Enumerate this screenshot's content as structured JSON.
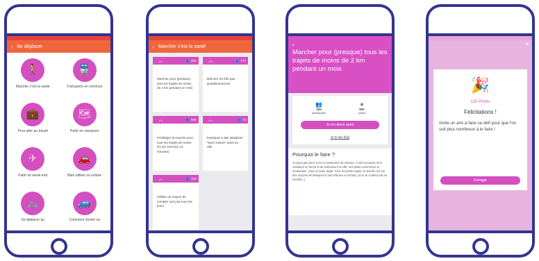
{
  "screen1": {
    "title": "Se déplacer",
    "items": [
      {
        "label": "Marcher c'est la santé",
        "icon": "🚶"
      },
      {
        "label": "Transports en commun",
        "icon": "🚆"
      },
      {
        "label": "Pour aller au travail",
        "icon": "💼"
      },
      {
        "label": "Partir en vacances",
        "icon": "🗺"
      },
      {
        "label": "Partir en week-end",
        "icon": "✈"
      },
      {
        "label": "Bien utiliser sa voiture",
        "icon": "🚗"
      },
      {
        "label": "Se déplacer au",
        "icon": "🚲"
      },
      {
        "label": "Comment choisir sa",
        "icon": "🚙"
      }
    ]
  },
  "screen2": {
    "title": "Marcher c'est la santé",
    "cards": [
      {
        "count": "404",
        "text": "Marcher pour (presque) tous les trajets de moins de 2 km pendant un mois"
      },
      {
        "count": "277",
        "text": "Marcher 10 000 pas quotidiennement"
      },
      {
        "count": "505",
        "text": "Privilégier la marche pour tous les trajets de moins d'1 km (environ 15 minutes)"
      },
      {
        "count": "73",
        "text": "Participer à des initiatives \"sans voiture\" dans sa ville"
      },
      {
        "count": "419",
        "text": "Utiliser un moyen de compter ses pas tous les jours"
      }
    ]
  },
  "screen3": {
    "title": "Marcher pour (presque) tous les trajets de moins de 2 km pendant un mois",
    "participants_value": "403",
    "participants_label": "participants",
    "points_value": "500",
    "points_label": "points",
    "cta": "Je me lance aussi",
    "link": "Je le fais déjà",
    "why_heading": "Pourquoi le faire ?",
    "why_text": "Tu peux parcourir 2 km en seulement 30 minutes. C'est l'occasion de te maintenir en forme et de redécouvrir ta ville, ses petits commerces et restaurants, sous un autre angle. Pour les petits trajets, la marche est l'un des moyens de transport le plus efficace et surtout, ça ne te coûtera pas un centime ;)"
  },
  "screen4": {
    "points": "125 Points",
    "title": "Félicitations !",
    "message": "Invite un ami à faire ce défi pour que l'on soit plus nombreux à le faire !",
    "share": "Partager"
  },
  "colors": {
    "frame": "#33348f",
    "appbar": "#f0663c",
    "accent": "#d44fc0"
  }
}
